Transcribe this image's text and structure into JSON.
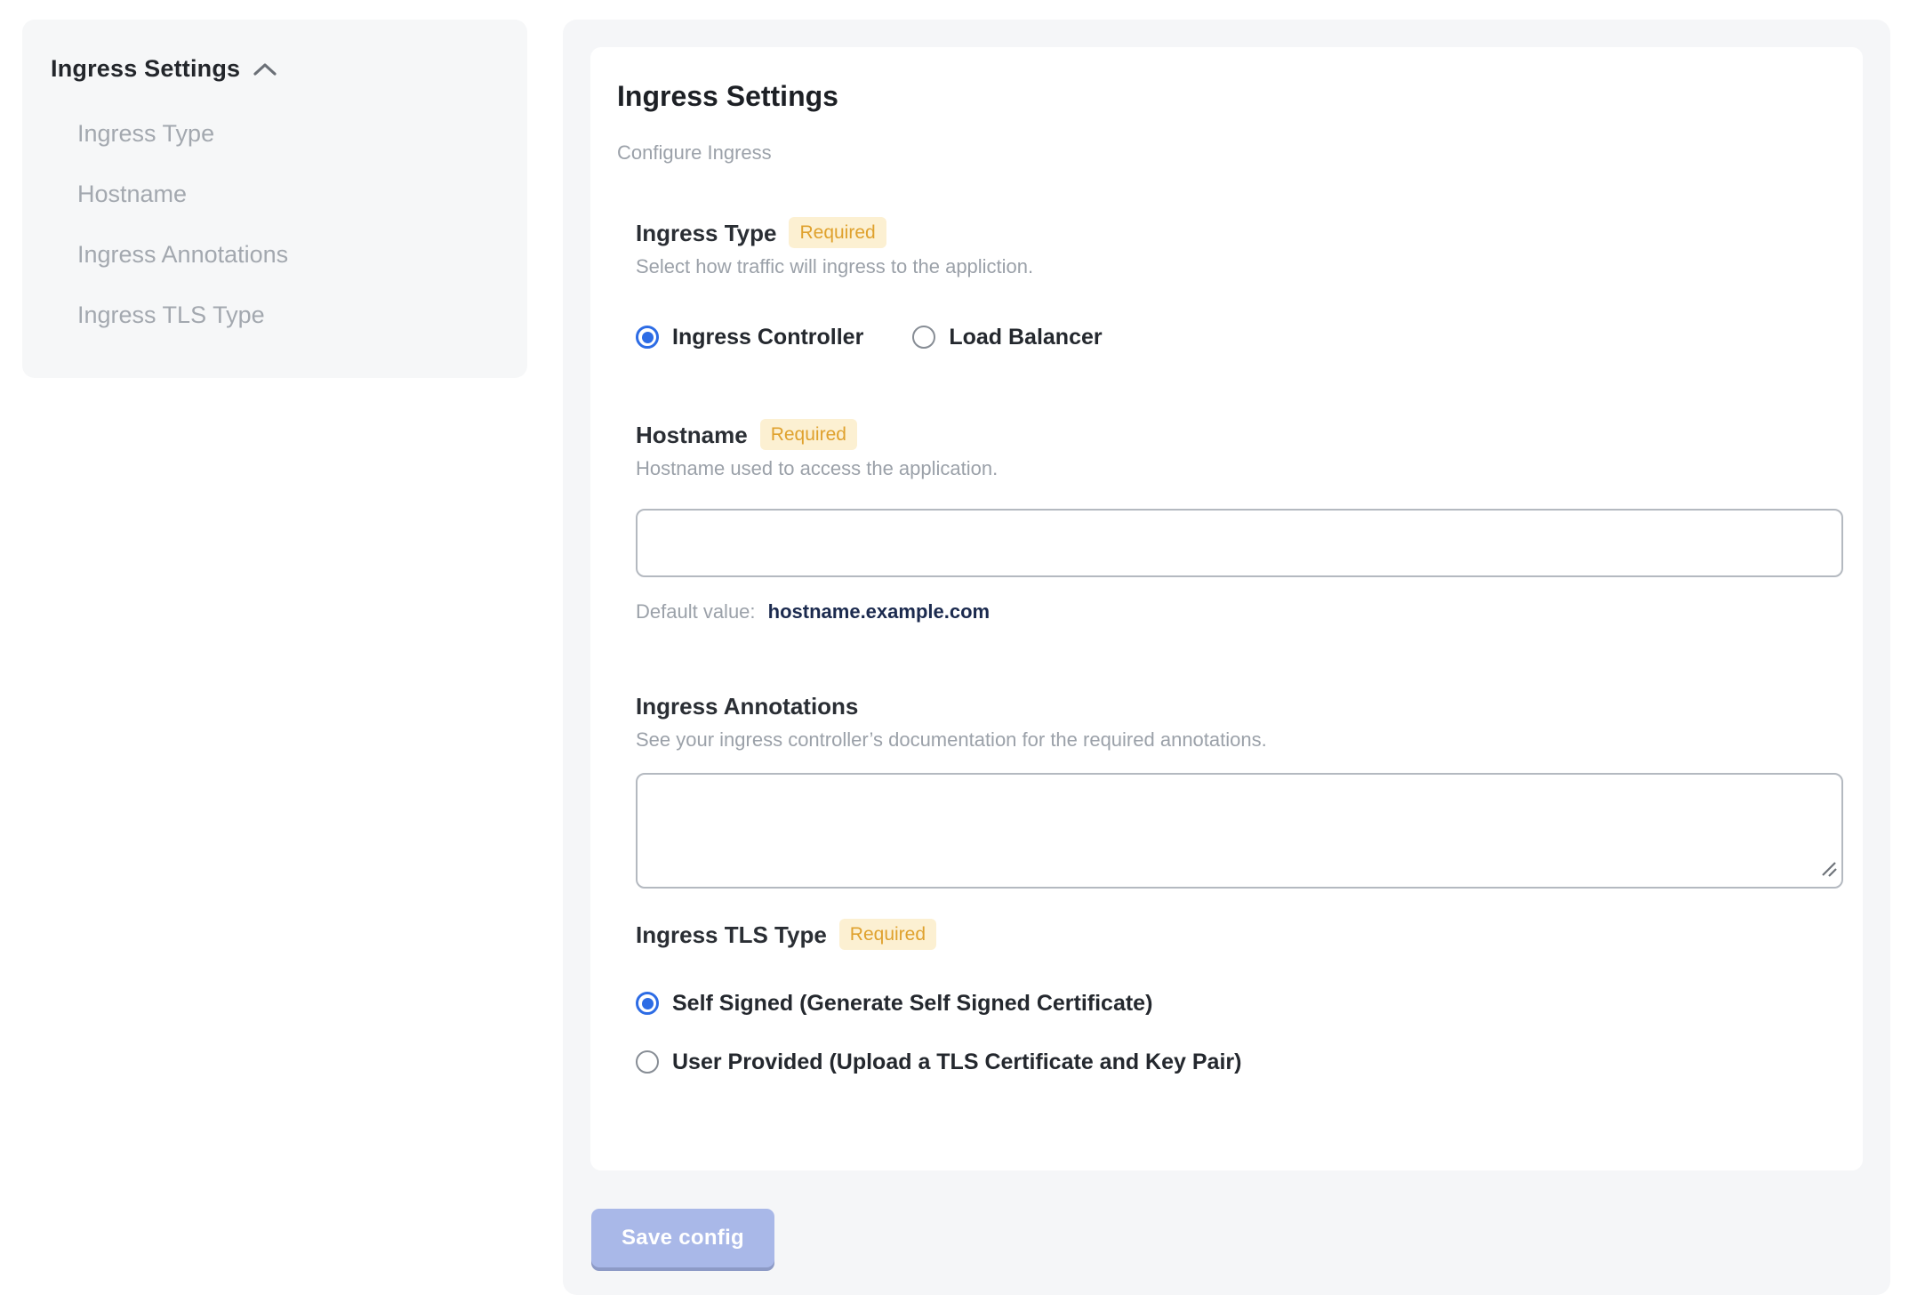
{
  "sidebar": {
    "title": "Ingress Settings",
    "collapse_icon": "chevron-up-icon",
    "items": [
      {
        "label": "Ingress Type"
      },
      {
        "label": "Hostname"
      },
      {
        "label": "Ingress Annotations"
      },
      {
        "label": "Ingress TLS Type"
      }
    ]
  },
  "panel": {
    "title": "Ingress Settings",
    "subtitle": "Configure Ingress",
    "required_label": "Required",
    "ingress_type": {
      "label": "Ingress Type",
      "required": true,
      "description": "Select how traffic will ingress to the appliction.",
      "options": [
        {
          "label": "Ingress Controller",
          "selected": true
        },
        {
          "label": "Load Balancer",
          "selected": false
        }
      ]
    },
    "hostname": {
      "label": "Hostname",
      "required": true,
      "description": "Hostname used to access the application.",
      "input_value": "",
      "input_placeholder": "",
      "default_value_label": "Default value:",
      "default_value": "hostname.example.com"
    },
    "annotations": {
      "label": "Ingress Annotations",
      "required": false,
      "description": "See your ingress controller’s documentation for the required annotations.",
      "textarea_value": "",
      "textarea_placeholder": ""
    },
    "tls": {
      "label": "Ingress TLS Type",
      "required": true,
      "options": [
        {
          "label": "Self Signed (Generate Self Signed Certificate)",
          "selected": true
        },
        {
          "label": "User Provided (Upload a TLS Certificate and Key Pair)",
          "selected": false
        }
      ]
    },
    "save_button_label": "Save config",
    "save_button_enabled": false
  },
  "colors": {
    "accent_blue": "#2d6ce5",
    "badge_background": "#fcf0d2",
    "badge_text": "#dfa12d",
    "save_button_background": "#a9b8e8",
    "default_value_text": "#1b2a4e",
    "panel_background": "#f5f6f8",
    "sidebar_background": "#f6f7f8"
  }
}
